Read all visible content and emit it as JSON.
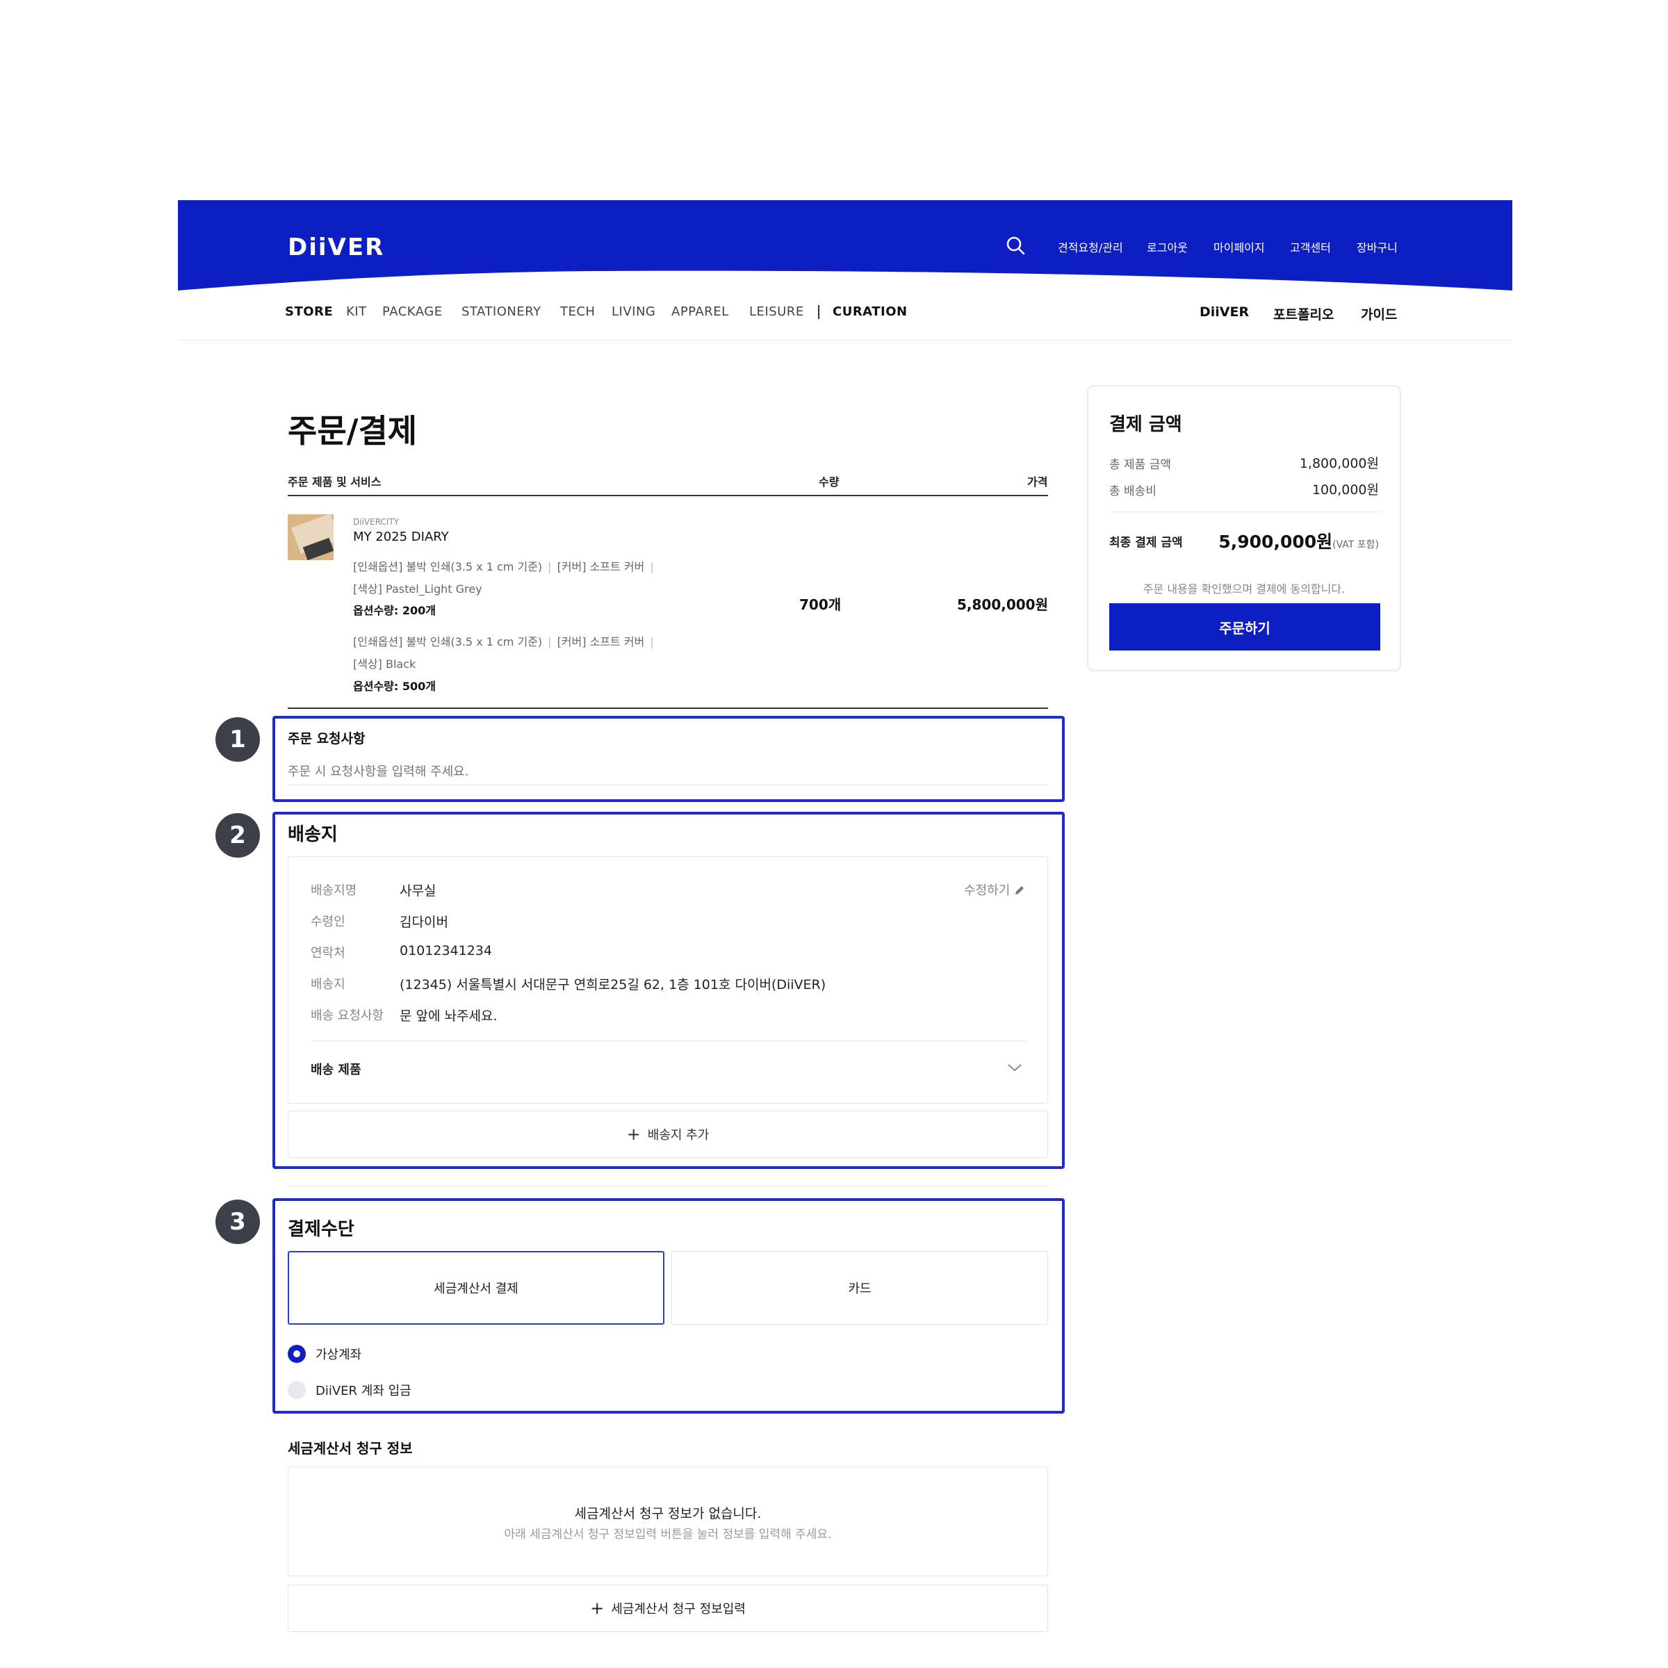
{
  "header": {
    "logo": "DiiVER",
    "links": [
      "견적요청/관리",
      "로그아웃",
      "마이페이지",
      "고객센터",
      "장바구니"
    ]
  },
  "categories": [
    "STORE",
    "KIT",
    "PACKAGE",
    "STATIONERY",
    "TECH",
    "LIVING",
    "APPAREL",
    "LEISURE",
    "CURATION"
  ],
  "brand_links": [
    "DiiVER",
    "포트폴리오",
    "가이드"
  ],
  "page_title": "주문/결제",
  "table_headers": {
    "product": "주문 제품 및 서비스",
    "qty": "수량",
    "price": "가격"
  },
  "product": {
    "brand": "DiiVERCITY",
    "name": "MY 2025 DIARY",
    "options": [
      {
        "print": "[인쇄옵션] 불박 인쇄(3.5 x 1 cm 기준)",
        "cover": "[커버] 소프트 커버",
        "color": "[색상] Pastel_Light Grey",
        "qty": "옵션수량: 200개"
      },
      {
        "print": "[인쇄옵션] 불박 인쇄(3.5 x 1 cm 기준)",
        "cover": "[커버] 소프트 커버",
        "color": "[색상] Black",
        "qty": "옵션수량: 500개"
      }
    ],
    "quantity": "700개",
    "price": "5,800,000원"
  },
  "annotations": [
    "1",
    "2",
    "3"
  ],
  "order_request": {
    "title": "주문 요청사항",
    "placeholder": "주문 시 요청사항을 입력해 주세요."
  },
  "shipping": {
    "title": "배송지",
    "edit": "수정하기",
    "rows": [
      {
        "label": "배송지명",
        "value": "사무실"
      },
      {
        "label": "수령인",
        "value": "김다이버"
      },
      {
        "label": "연락처",
        "value": "01012341234"
      },
      {
        "label": "배송지",
        "value": "(12345) 서울특별시 서대문구 연희로25길 62, 1층 101호 다이버(DiiVER)"
      },
      {
        "label": "배송 요청사항",
        "value": "문 앞에 놔주세요."
      }
    ],
    "products_label": "배송 제품",
    "add_label": "배송지 추가"
  },
  "payment": {
    "title": "결제수단",
    "tabs": [
      "세금계산서 결제",
      "카드"
    ],
    "options": [
      "가상계좌",
      "DiiVER 계좌 입금"
    ]
  },
  "tax_invoice": {
    "title": "세금계산서 청구 정보",
    "empty": "세금계산서 청구 정보가 없습니다.",
    "hint": "아래 세금계산서 청구 정보입력 버튼을 눌러 정보를 입력해 주세요.",
    "add_label": "세금계산서 청구 정보입력"
  },
  "summary": {
    "title": "결제 금액",
    "product_total_label": "총 제품 금액",
    "product_total": "1,800,000원",
    "shipping_label": "총 배송비",
    "shipping": "100,000원",
    "final_label": "최종 결제 금액",
    "final": "5,900,000원",
    "vat": "(VAT 포함)",
    "agree": "주문 내용을 확인했으며 결제에 동의합니다.",
    "order_button": "주문하기"
  },
  "colors": {
    "brand_blue": "#0d1fc2",
    "annotation_border": "#1e2bc6",
    "annotation_badge": "#3d3f49"
  }
}
